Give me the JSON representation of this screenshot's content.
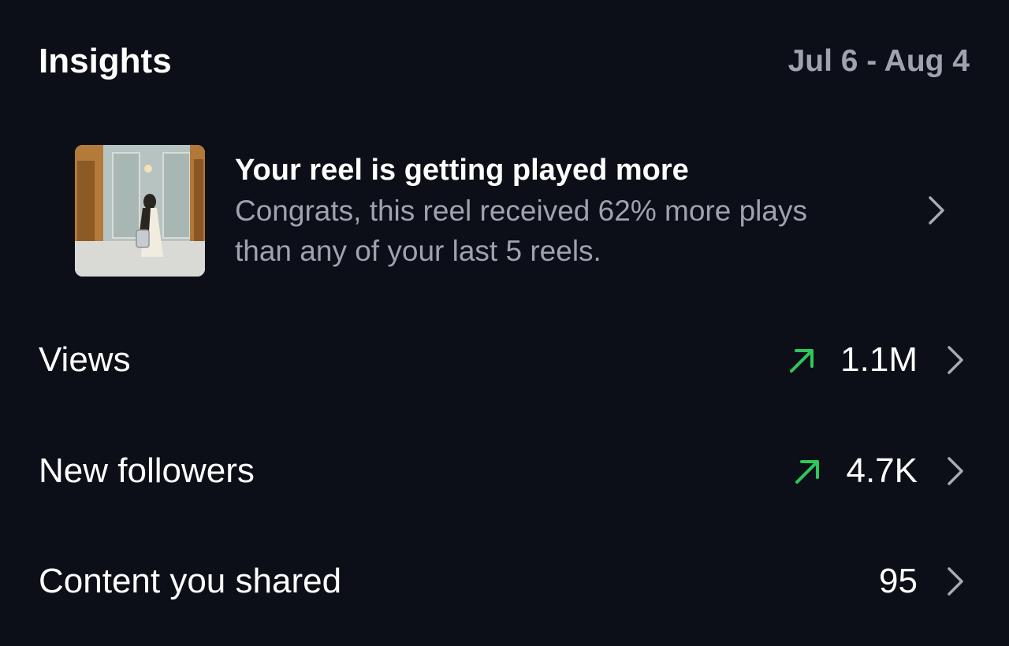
{
  "header": {
    "title": "Insights",
    "date_range": "Jul 6 - Aug 4"
  },
  "reel_card": {
    "title": "Your reel is getting played more",
    "description": "Congrats, this reel received 62% more plays than any of your last 5 reels.",
    "thumbnail_icon": "reel-thumbnail-image",
    "chevron_icon": "chevron-right-icon"
  },
  "metrics": [
    {
      "label": "Views",
      "value": "1.1M",
      "trend": "up"
    },
    {
      "label": "New followers",
      "value": "4.7K",
      "trend": "up"
    },
    {
      "label": "Content you shared",
      "value": "95",
      "trend": "none"
    }
  ],
  "colors": {
    "background": "#0c0f17",
    "primary_text": "#ffffff",
    "secondary_text": "#9ea3ad",
    "trend_up": "#2ec75a",
    "chevron": "#a7abb3"
  }
}
